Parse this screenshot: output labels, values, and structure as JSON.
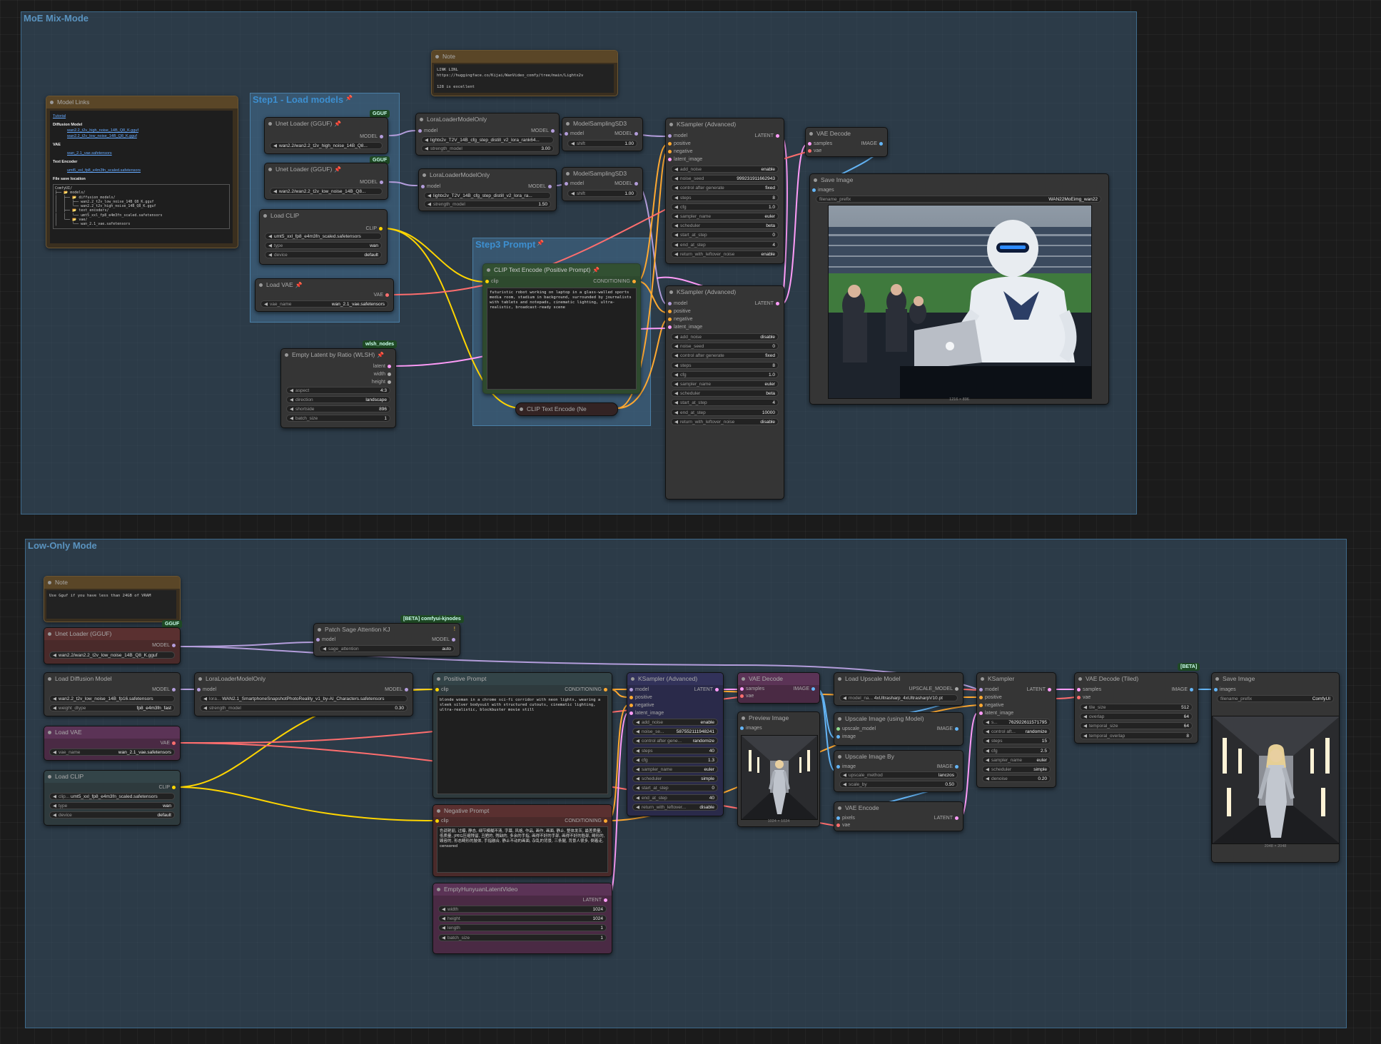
{
  "groups": {
    "moe": "MoE Mix-Mode",
    "step1": "Step1 - Load models",
    "step3": "Step3 Prompt",
    "low": "Low-Only Mode"
  },
  "badges": {
    "gguf": "GGUF",
    "wlsh": "wlsh_nodes",
    "kj": "[BETA] comfyui-kjnodes",
    "beta": "[BETA]"
  },
  "top": {
    "note": {
      "title": "Note",
      "text": "LINK LINL\nhttps://huggingface.co/Kijai/WanVideo_comfy/tree/main/Lightx2v\n\n128 is excellent"
    },
    "model_links": {
      "title": "Model Links",
      "tutorial": "Tutorial",
      "diffusion_header": "Diffusion Model",
      "diffusion_1": "wan2.2_t2v_high_noise_14B_Q8_K.gguf",
      "diffusion_2": "wan2.2_t2v_low_noise_14B_Q8_K.gguf",
      "vae_header": "VAE",
      "vae_1": "wan_2.1_vae.safetensors",
      "text_header": "Text Encoder",
      "text_1": "umt5_xxl_fp8_e4m3fn_scaled.safetensors",
      "file_header": "File save location",
      "tree": "ComfyUI/\n├── 📂 models/\n│   ├── 📂 diffusion_models/\n│   │   ├── wan2.2_t2v_low_noise_14B_Q8_K.gguf\n│   │   └── wan2.2_t2v_high_noise_14B_Q8_K.gguf\n│   ├── 📂 text_encoders/\n│   │   └── umt5_xxl_fp8_e4m3fn_scaled.safetensors\n│   └── 📂 vae/\n│       └── wan_2.1_vae.safetensors"
    },
    "unet1": {
      "title": "Unet Loader (GGUF)",
      "out": "MODEL",
      "value": "wan2.2/wan2.2_t2v_high_noise_14B_Q8..."
    },
    "unet2": {
      "title": "Unet Loader (GGUF)",
      "out": "MODEL",
      "value": "wan2.2/wan2.2_t2v_low_noise_14B_Q8..."
    },
    "clip": {
      "title": "Load CLIP",
      "out": "CLIP",
      "name": "umt5_xxl_fp8_e4m3fn_scaled.safetensors",
      "type_l": "type",
      "type_v": "wan",
      "device_l": "device",
      "device_v": "default"
    },
    "vae": {
      "title": "Load VAE",
      "out": "VAE",
      "l": "vae_name",
      "v": "wan_2.1_vae.safetensors"
    },
    "lora1": {
      "title": "LoraLoaderModelOnly",
      "in": "model",
      "out": "MODEL",
      "value": "lightx2v_T2V_14B_cfg_step_distill_v2_lora_rank64...",
      "str_l": "strength_model",
      "str_v": "3.00"
    },
    "lora2": {
      "title": "LoraLoaderModelOnly",
      "in": "model",
      "out": "MODEL",
      "value": "lightx2v_T2V_14B_cfg_step_distill_v2_lora_ra...",
      "str_l": "strength_model",
      "str_v": "1.50"
    },
    "ms1": {
      "title": "ModelSamplingSD3",
      "in": "model",
      "out": "MODEL",
      "l": "shift",
      "v": "1.00"
    },
    "ms2": {
      "title": "ModelSamplingSD3",
      "in": "model",
      "out": "MODEL",
      "l": "shift",
      "v": "1.00"
    },
    "latent": {
      "title": "Empty Latent by Ratio (WLSH)",
      "o1": "latent",
      "o2": "width",
      "o3": "height",
      "w": [
        [
          "aspect",
          "4:3"
        ],
        [
          "direction",
          "landscape"
        ],
        [
          "shortside",
          "896"
        ],
        [
          "batch_size",
          "1"
        ]
      ]
    },
    "pos": {
      "title": "CLIP Text Encode (Positive Prompt)",
      "in": "clip",
      "out": "CONDITIONING",
      "text": "futuristic robot working on laptop in a glass-walled sports media room, stadium in background, surrounded by journalists with tablets and notepads, cinematic lighting, ultra-realistic, broadcast-ready scene"
    },
    "neg": {
      "title": "CLIP Text Encode (Ne"
    },
    "ks1": {
      "title": "KSampler (Advanced)",
      "ins": [
        "model",
        "positive",
        "negative",
        "latent_image"
      ],
      "out": "LATENT",
      "w": [
        [
          "add_noise",
          "enable"
        ],
        [
          "noise_seed",
          "999231911662943"
        ],
        [
          "control after generate",
          "fixed"
        ],
        [
          "steps",
          "8"
        ],
        [
          "cfg",
          "1.0"
        ],
        [
          "sampler_name",
          "euler"
        ],
        [
          "scheduler",
          "beta"
        ],
        [
          "start_at_step",
          "0"
        ],
        [
          "end_at_step",
          "4"
        ],
        [
          "return_with_leftover_noise",
          "enable"
        ]
      ]
    },
    "ks2": {
      "title": "KSampler (Advanced)",
      "ins": [
        "model",
        "positive",
        "negative",
        "latent_image"
      ],
      "out": "LATENT",
      "w": [
        [
          "add_noise",
          "disable"
        ],
        [
          "noise_seed",
          "0"
        ],
        [
          "control after generate",
          "fixed"
        ],
        [
          "steps",
          "8"
        ],
        [
          "cfg",
          "1.0"
        ],
        [
          "sampler_name",
          "euler"
        ],
        [
          "scheduler",
          "beta"
        ],
        [
          "start_at_step",
          "4"
        ],
        [
          "end_at_step",
          "10000"
        ],
        [
          "return_with_leftover_noise",
          "disable"
        ]
      ]
    },
    "vaedec": {
      "title": "VAE Decode",
      "i1": "samples",
      "i2": "vae",
      "out": "IMAGE"
    },
    "save": {
      "title": "Save Image",
      "in": "images",
      "l": "filename_prefix",
      "v": "WAN22MoEimg_wan22",
      "size": "1216 × 896"
    }
  },
  "bottom": {
    "note": {
      "title": "Note",
      "text": "Use Gguf if you have less than 24GB of VRAM"
    },
    "unet": {
      "title": "Unet Loader (GGUF)",
      "out": "MODEL",
      "value": "wan2.2/wan2.2_t2v_low_noise_14B_Q8_K.gguf"
    },
    "sage": {
      "title": "Patch Sage Attention KJ",
      "in": "model",
      "out": "MODEL",
      "l": "sage_attention",
      "v": "auto"
    },
    "diff": {
      "title": "Load Diffusion Model",
      "out": "MODEL",
      "value": "wan2.2_t2v_low_noise_14B_fp16.safetensors",
      "l": "weight_dtype",
      "v": "fp8_e4m3fn_fast"
    },
    "lora": {
      "title": "LoraLoaderModelOnly",
      "in": "model",
      "out": "MODEL",
      "l1": "lora...",
      "v1": "WAN2.1_SmartphoneSnapshotPhotoReality_v1_by-AI_Characters.safetensors",
      "l2": "strength_model",
      "v2": "0.30"
    },
    "vae": {
      "title": "Load VAE",
      "out": "VAE",
      "l": "vae_name",
      "v": "wan_2.1_vae.safetensors"
    },
    "clip": {
      "title": "Load CLIP",
      "out": "CLIP",
      "w": [
        [
          "clip...",
          "umt5_xxl_fp8_e4m3fn_scaled.safetensors"
        ],
        [
          "type",
          "wan"
        ],
        [
          "device",
          "default"
        ]
      ]
    },
    "pos": {
      "title": "Positive Prompt",
      "in": "clip",
      "out": "CONDITIONING",
      "text": "blonde woman in a chrome sci-fi corridor with neon lights, wearing a sleek silver bodysuit with structured cutouts, cinematic lighting, ultra-realistic, blockbuster movie still"
    },
    "neg": {
      "title": "Negative Prompt",
      "in": "clip",
      "out": "CONDITIONING",
      "text": "色调艳丽, 过曝, 静态, 细节模糊不清, 字幕, 风格, 作品, 画作, 画面, 静止, 整体发灰, 最差质量, 低质量, JPEG压缩残留, 丑陋的, 残缺的, 多余的手指, 画得不好的手部, 画得不好的脸部, 畸形的, 毁容的, 形态畸形的肢体, 手指融合, 静止不动的画面, 杂乱的背景, 三条腿, 背景人很多, 倒着走, censored"
    },
    "empty": {
      "title": "EmptyHunyuanLatentVideo",
      "out": "LATENT",
      "w": [
        [
          "width",
          "1024"
        ],
        [
          "height",
          "1024"
        ],
        [
          "length",
          "1"
        ],
        [
          "batch_size",
          "1"
        ]
      ]
    },
    "ks": {
      "title": "KSampler (Advanced)",
      "ins": [
        "model",
        "positive",
        "negative",
        "latent_image"
      ],
      "out": "LATENT",
      "w": [
        [
          "add_noise",
          "enable"
        ],
        [
          "noise_se...",
          "587552111948241"
        ],
        [
          "control after gene...",
          "randomize"
        ],
        [
          "steps",
          "40"
        ],
        [
          "cfg",
          "1.3"
        ],
        [
          "sampler_name",
          "euler"
        ],
        [
          "scheduler",
          "simple"
        ],
        [
          "start_at_step",
          "0"
        ],
        [
          "end_at_step",
          "40"
        ],
        [
          "return_with_leftover...",
          "disable"
        ]
      ]
    },
    "vaedec": {
      "title": "VAE Decode",
      "i1": "samples",
      "i2": "vae",
      "out": "IMAGE"
    },
    "preview": {
      "title": "Preview Image",
      "in": "images",
      "size": "1024 × 1024"
    },
    "upmodel": {
      "title": "Load Upscale Model",
      "out": "UPSCALE_MODEL",
      "l": "model_na...",
      "v": "4xUltrasharp_4xUltrasharpV10.pt"
    },
    "upimg": {
      "title": "Upscale Image (using Model)",
      "i1": "upscale_model",
      "i2": "image",
      "out": "IMAGE"
    },
    "upby": {
      "title": "Upscale Image By",
      "in": "image",
      "out": "IMAGE",
      "w": [
        [
          "upscale_method",
          "lanczos"
        ],
        [
          "scale_by",
          "0.50"
        ]
      ]
    },
    "vaeenc": {
      "title": "VAE Encode",
      "i1": "pixels",
      "i2": "vae",
      "out": "LATENT"
    },
    "ks2": {
      "title": "KSampler",
      "ins": [
        "model",
        "positive",
        "negative",
        "latent_image"
      ],
      "out": "LATENT",
      "w": [
        [
          "s...",
          "762922611571795"
        ],
        [
          "control aft...",
          "randomize"
        ],
        [
          "steps",
          "15"
        ],
        [
          "cfg",
          "2.5"
        ],
        [
          "sampler_name",
          "euler"
        ],
        [
          "scheduler",
          "simple"
        ],
        [
          "denoise",
          "0.20"
        ]
      ]
    },
    "vaetiled": {
      "title": "VAE Decode (Tiled)",
      "i1": "samples",
      "i2": "vae",
      "out": "IMAGE",
      "w": [
        [
          "tile_size",
          "512"
        ],
        [
          "overlap",
          "64"
        ],
        [
          "temporal_size",
          "64"
        ],
        [
          "temporal_overlap",
          "8"
        ]
      ]
    },
    "save": {
      "title": "Save Image",
      "in": "images",
      "l": "filename_prefix",
      "v": "ComfyUI",
      "size": "2048 × 2048"
    }
  },
  "colors": {
    "model": "#b39ddb",
    "clip": "#ffd500",
    "vae": "#ff6e6e",
    "latent": "#ff9cf9",
    "conditioning": "#ffa931",
    "image": "#64b5f6"
  }
}
